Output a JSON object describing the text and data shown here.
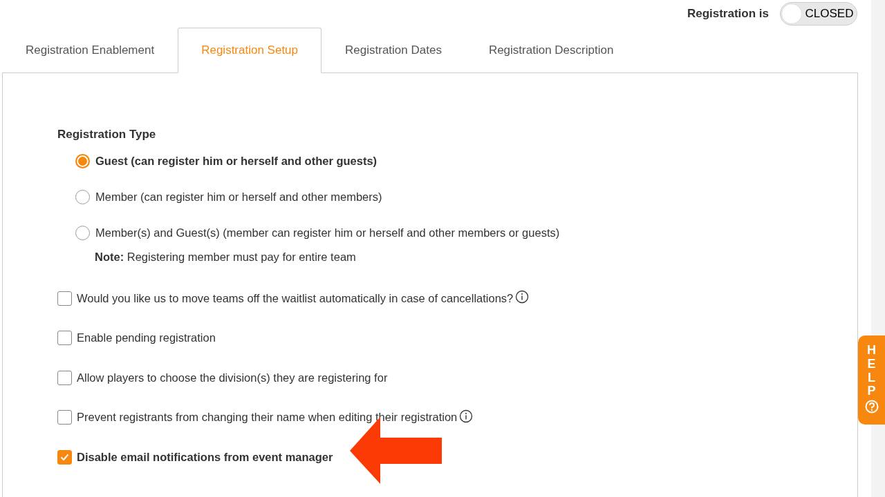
{
  "registration_status": {
    "label": "Registration is",
    "toggle_text": "CLOSED",
    "on": false
  },
  "tabs": [
    {
      "label": "Registration Enablement",
      "selected": false
    },
    {
      "label": "Registration Setup",
      "selected": true
    },
    {
      "label": "Registration Dates",
      "selected": false
    },
    {
      "label": "Registration Description",
      "selected": false
    }
  ],
  "registration_type": {
    "heading": "Registration Type",
    "options": [
      {
        "label": "Guest (can register him or herself and other guests)",
        "selected": true
      },
      {
        "label": "Member (can register him or herself and other members)",
        "selected": false
      },
      {
        "label": "Member(s) and Guest(s) (member can register him or herself and other members or guests)",
        "selected": false
      }
    ],
    "note": "**Note:** Registering member must pay for entire team"
  },
  "options": [
    {
      "label": "Would you like us to move teams off the waitlist automatically in case of cancellations?",
      "checked": false,
      "info": true
    },
    {
      "label": "Enable pending registration",
      "checked": false,
      "info": false
    },
    {
      "label": "Allow players to choose the division(s) they are registering for",
      "checked": false,
      "info": false
    },
    {
      "label": "Prevent registrants from changing their name when editing their registration",
      "checked": false,
      "info": true
    },
    {
      "label": "Disable email notifications from event manager",
      "checked": true,
      "info": false
    }
  ],
  "help_tab": {
    "label": "HELP"
  }
}
